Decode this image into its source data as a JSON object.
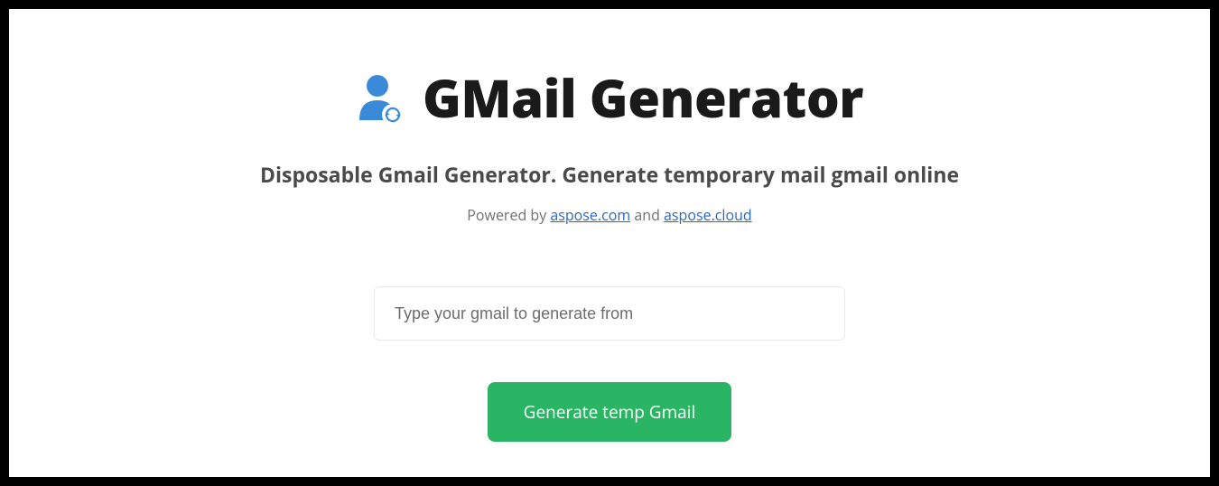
{
  "header": {
    "title": "GMail Generator",
    "subtitle": "Disposable Gmail Generator. Generate temporary mail gmail online",
    "powered_prefix": "Powered by ",
    "powered_link1": "aspose.com",
    "powered_sep": " and ",
    "powered_link2": "aspose.cloud"
  },
  "form": {
    "email_placeholder": "Type your gmail to generate from",
    "email_value": "",
    "generate_label": "Generate temp Gmail"
  },
  "icons": {
    "person": "person-refresh-icon"
  },
  "colors": {
    "accent_blue": "#3b8ad9",
    "accent_green": "#2ab564",
    "link": "#2869c5"
  }
}
